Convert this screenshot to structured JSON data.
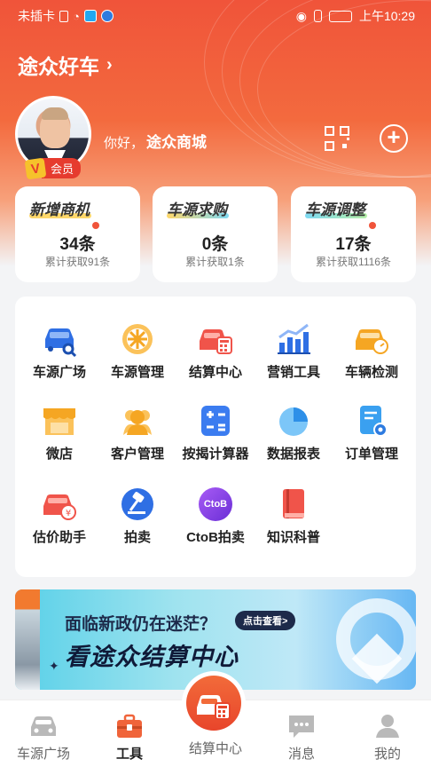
{
  "status_bar": {
    "carrier": "未插卡",
    "time": "上午10:29"
  },
  "header": {
    "brand": "途众好车",
    "greeting_prefix": "你好，",
    "greeting_name": "途众商城",
    "member_badge": "会员",
    "vip_glyph": "V"
  },
  "stats": [
    {
      "title": "新增商机",
      "value": "34条",
      "sub": "累计获取91条",
      "highlight": "#ffd86b",
      "has_dot": true
    },
    {
      "title": "车源求购",
      "value": "0条",
      "sub": "累计获取1条",
      "highlight": "#7fd9f2",
      "has_dot": false
    },
    {
      "title": "车源调整",
      "value": "17条",
      "sub": "累计获取1116条",
      "highlight": "#7fd9f2",
      "has_dot": true
    }
  ],
  "tools": [
    {
      "label": "车源广场",
      "icon": "car-search-icon",
      "color": "#2f6fe4"
    },
    {
      "label": "车源管理",
      "icon": "wheel-icon",
      "color": "#f5a623"
    },
    {
      "label": "结算中心",
      "icon": "car-calculator-icon",
      "color": "#f0544a"
    },
    {
      "label": "营销工具",
      "icon": "bar-chart-growth-icon",
      "color": "#2f6fe4"
    },
    {
      "label": "车辆检测",
      "icon": "car-gauge-icon",
      "color": "#f5a623"
    },
    {
      "label": "微店",
      "icon": "storefront-icon",
      "color": "#f5a623"
    },
    {
      "label": "客户管理",
      "icon": "users-icon",
      "color": "#f5a623"
    },
    {
      "label": "按揭计算器",
      "icon": "calculator-icon",
      "color": "#2f6fe4"
    },
    {
      "label": "数据报表",
      "icon": "pie-chart-icon",
      "color": "#3aa0f0"
    },
    {
      "label": "订单管理",
      "icon": "order-settings-icon",
      "color": "#3aa0f0"
    },
    {
      "label": "估价助手",
      "icon": "car-valuation-icon",
      "color": "#f0544a"
    },
    {
      "label": "拍卖",
      "icon": "gavel-icon",
      "color": "#2f6fe4"
    },
    {
      "label": "CtoB拍卖",
      "icon": "ctob-icon",
      "color": "#8b3fe0",
      "icon_text": "CtoB"
    },
    {
      "label": "知识科普",
      "icon": "book-icon",
      "color": "#f0544a"
    }
  ],
  "banner": {
    "line1": "面临新政仍在迷茫？",
    "cta": "点击查看>",
    "line2": "看途众结算中心"
  },
  "tabbar": [
    {
      "label": "车源广场",
      "icon": "car-icon",
      "active": false
    },
    {
      "label": "工具",
      "icon": "toolbox-icon",
      "active": true
    },
    {
      "label": "结算中心",
      "icon": "car-calculator-icon",
      "active": false
    },
    {
      "label": "消息",
      "icon": "chat-icon",
      "active": false
    },
    {
      "label": "我的",
      "icon": "person-icon",
      "active": false
    }
  ]
}
